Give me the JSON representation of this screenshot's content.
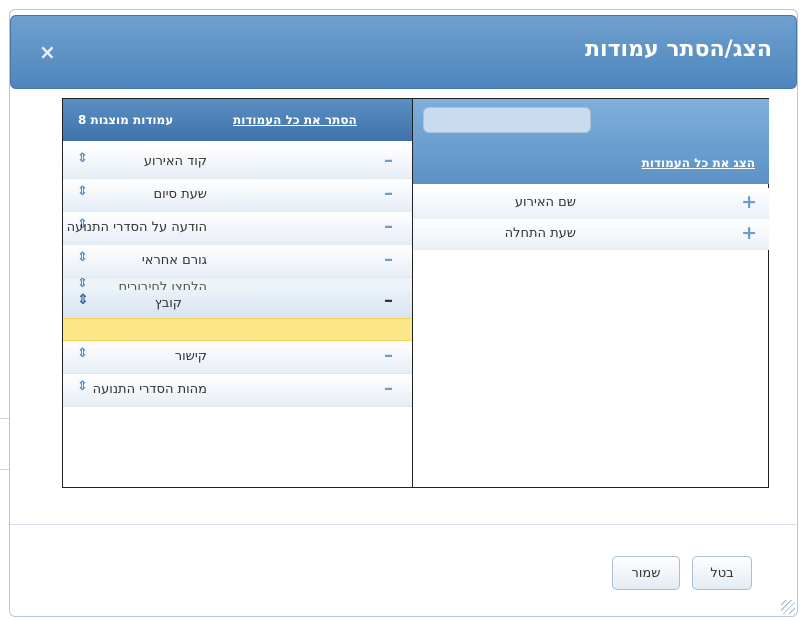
{
  "dialog": {
    "title": "הצג/הסתר עמודות",
    "close_glyph": "×"
  },
  "available": {
    "search_placeholder": "",
    "show_all_label": "הצג את כל העמודות",
    "items": [
      {
        "label": "שם האירוע",
        "action": "+"
      },
      {
        "label": "שעת התחלה",
        "action": "+"
      }
    ]
  },
  "displayed": {
    "hide_all_label": "הסתר את כל העמודות",
    "count_label": "עמודות מוצגות 8",
    "items_before": [
      {
        "label": "קוד האירוע"
      },
      {
        "label": "שעת סיום"
      },
      {
        "label": "הודעה על הסדרי התנועה"
      },
      {
        "label": "גורם אחראי"
      }
    ],
    "ghost_item": {
      "label": "הלחצן לחיבורים"
    },
    "dragging_item": {
      "label": "קובץ"
    },
    "items_after": [
      {
        "label": "קישור"
      },
      {
        "label": "מהות הסדרי התנועה"
      }
    ],
    "drag_glyph": "⇕",
    "remove_glyph": "–"
  },
  "footer": {
    "cancel_label": "בטל",
    "save_label": "שמור"
  },
  "colors": {
    "header_blue": "#4f86bd",
    "placeholder_yellow": "#fbe68a"
  }
}
